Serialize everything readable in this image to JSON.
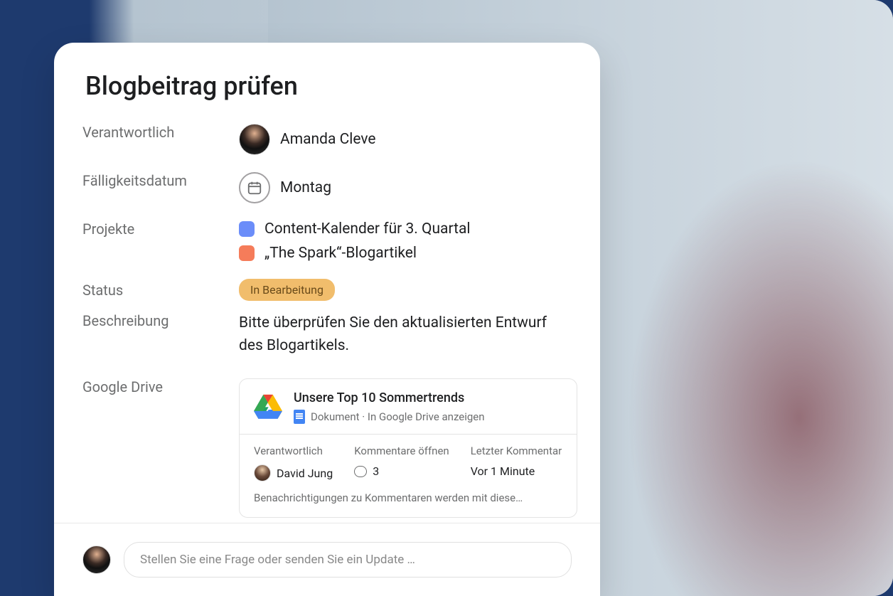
{
  "task": {
    "title": "Blogbeitrag prüfen",
    "fields": {
      "assignee_label": "Verantwortlich",
      "assignee_name": "Amanda Cleve",
      "due_label": "Fälligkeitsdatum",
      "due_value": "Montag",
      "projects_label": "Projekte",
      "status_label": "Status",
      "status_value": "In Bearbeitung",
      "description_label": "Beschreibung",
      "description_text": "Bitte überprüfen Sie den aktualisierten Entwurf des Blogartikels.",
      "drive_label": "Google Drive"
    },
    "projects": [
      {
        "color": "#6b8df9",
        "name": "Content-Kalender für 3. Quartal"
      },
      {
        "color": "#f57c5a",
        "name": "„The Spark“-Blogartikel"
      }
    ]
  },
  "drive": {
    "title": "Unsere Top 10 Sommertrends",
    "subtitle": "Dokument · In Google Drive anzeigen",
    "meta": {
      "owner_label": "Verantwortlich",
      "owner_name": "David Jung",
      "comments_label": "Kommentare öffnen",
      "comments_count": "3",
      "last_label": "Letzter Kommentar",
      "last_value": "Vor 1 Minute"
    },
    "footer": "Benachrichtigungen zu Kommentaren werden mit diese…"
  },
  "comment": {
    "placeholder": "Stellen Sie eine Frage oder senden Sie ein Update …"
  }
}
